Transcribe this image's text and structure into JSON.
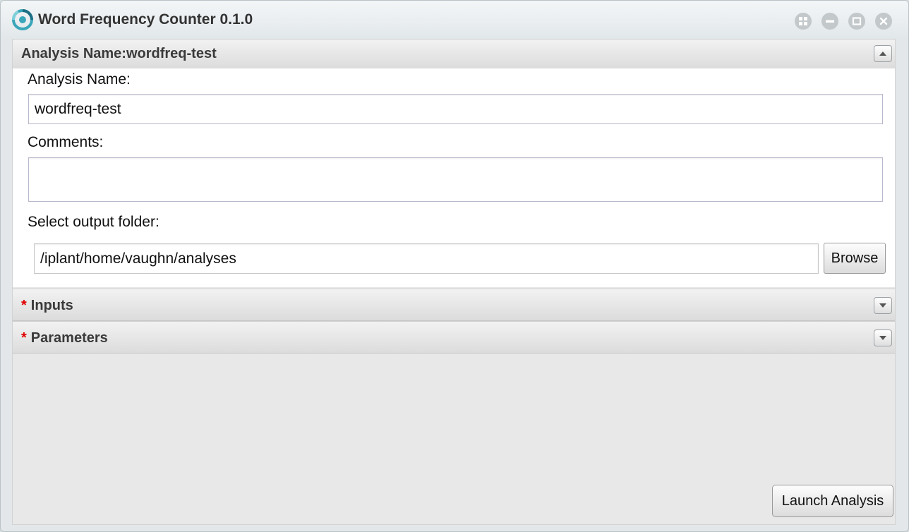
{
  "window": {
    "title": "Word Frequency Counter 0.1.0",
    "logo_icon": "app-logo-icon",
    "controls": [
      "grid-icon",
      "minimize-icon",
      "maximize-icon",
      "close-icon"
    ]
  },
  "sections": {
    "analysis": {
      "header": "Analysis Name:wordfreq-test",
      "state": "expanded",
      "toggle_icon": "chevron-up-icon"
    },
    "inputs": {
      "header": "Inputs",
      "required_marker": "*",
      "state": "collapsed",
      "toggle_icon": "chevron-down-icon"
    },
    "parameters": {
      "header": "Parameters",
      "required_marker": "*",
      "state": "collapsed",
      "toggle_icon": "chevron-down-icon"
    }
  },
  "form": {
    "analysis_name_label": "Analysis Name:",
    "analysis_name_value": "wordfreq-test",
    "comments_label": "Comments:",
    "comments_value": "",
    "output_folder_label": "Select output folder:",
    "output_folder_value": "/iplant/home/vaughn/analyses",
    "browse_label": "Browse"
  },
  "footer": {
    "launch_label": "Launch Analysis"
  },
  "colors": {
    "required_star": "#e10000",
    "logo_accent": "#3aa6b9"
  }
}
